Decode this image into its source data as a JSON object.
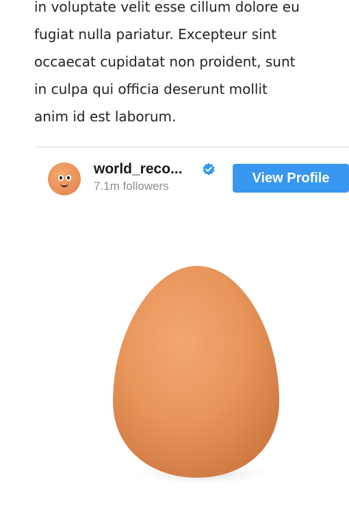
{
  "article": {
    "lines": [
      "in voluptate velit esse cillum dolore eu",
      "fugiat nulla pariatur. Excepteur sint",
      "occaecat cupidatat non proident, sunt",
      "in culpa qui officia deserunt mollit",
      "anim id est laborum."
    ]
  },
  "embed": {
    "username": "world_reco...",
    "followers": "7.1m followers",
    "view_profile_label": "View Profile",
    "verified_icon": "verified-badge-icon",
    "avatar_icon": "egg-face-avatar",
    "post_image": "egg-photo"
  },
  "colors": {
    "button": "#3897f0",
    "verified": "#3897f0",
    "egg": "#e8955b",
    "divider": "#dbdbdb",
    "muted_text": "#8e8e8e"
  }
}
